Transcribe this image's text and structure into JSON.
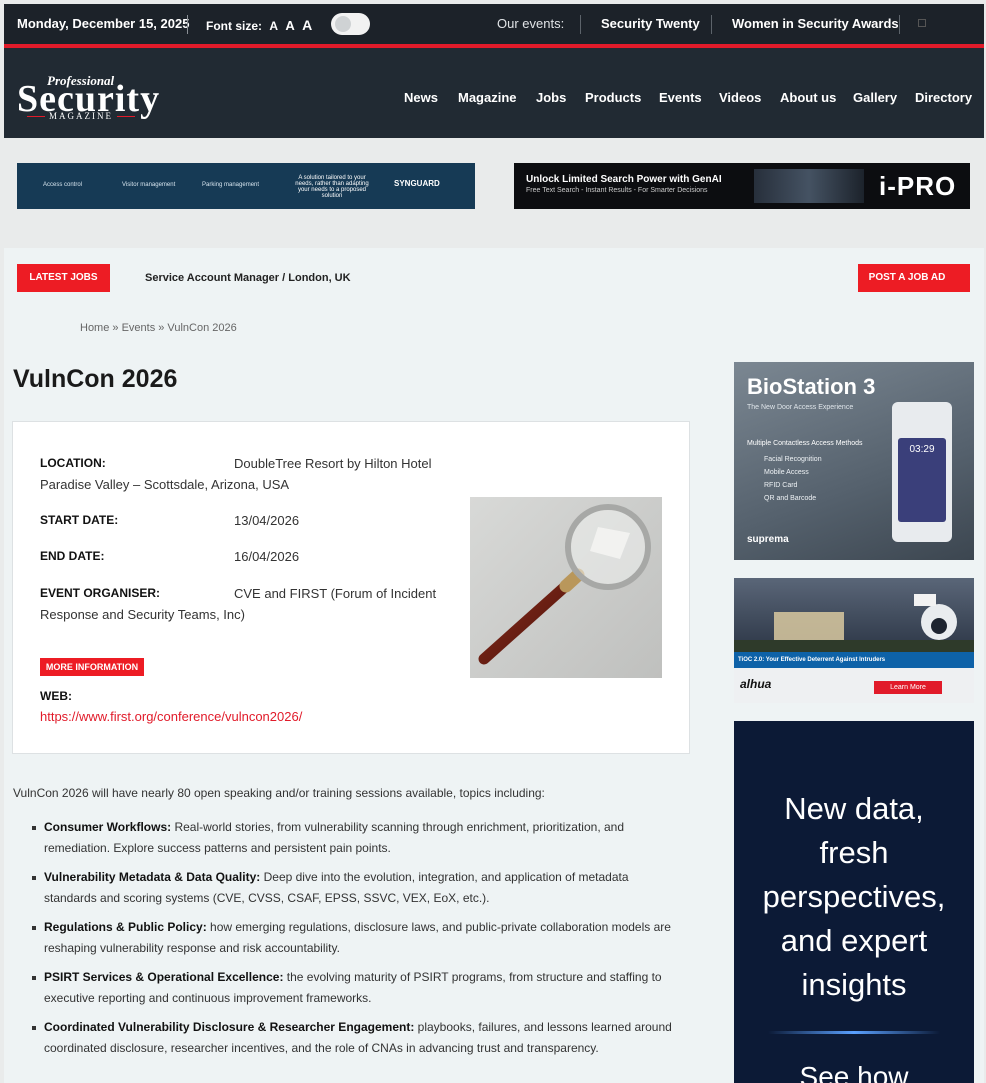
{
  "topbar": {
    "date": "Monday, December 15, 2025",
    "font_size_label": "Font size:",
    "font_a": "A",
    "events_label": "Our events:",
    "event1": "Security Twenty",
    "event2": "Women in Security Awards"
  },
  "header": {
    "logo_professional": "Professional",
    "logo_security": "Security",
    "logo_magazine": "MAGAZINE",
    "nav": [
      "News",
      "Magazine",
      "Jobs",
      "Products",
      "Events",
      "Videos",
      "About us",
      "Gallery",
      "Directory"
    ]
  },
  "ads": {
    "ad1_items": [
      "Access control",
      "Visitor management",
      "Parking management"
    ],
    "ad1_tagline": "A solution tailored to your needs, rather than adapting your needs to a proposed solution",
    "ad1_brand": "SYNGUARD",
    "ad2_title": "Unlock Limited Search Power with GenAI",
    "ad2_sub": "Free Text Search - Instant Results - For Smarter Decisions",
    "ad2_brand": "i-PRO"
  },
  "jobs": {
    "latest_label": "LATEST JOBS",
    "job": "Service Account Manager / London, UK",
    "post_label": "POST A JOB AD"
  },
  "breadcrumb": "Home » Events » VulnCon 2026",
  "event": {
    "title": "VulnCon 2026",
    "location_label": "LOCATION:",
    "location_value": "DoubleTree Resort by Hilton Hotel",
    "location_value2": "Paradise Valley – Scottsdale, Arizona, USA",
    "start_label": "START DATE:",
    "start_value": "13/04/2026",
    "end_label": "END DATE:",
    "end_value": "16/04/2026",
    "organiser_label": "EVENT ORGANISER:",
    "organiser_value": "CVE and FIRST (Forum of Incident",
    "organiser_value2": "Response and Security Teams, Inc)",
    "more_info": "MORE INFORMATION",
    "web_label": "WEB:",
    "web_url": "https://www.first.org/conference/vulncon2026/"
  },
  "content": {
    "intro": "VulnCon 2026 will have nearly 80 open speaking and/or training sessions available, topics including:",
    "bullets": [
      {
        "head": "Consumer Workflows:",
        "body": " Real-world stories, from vulnerability scanning through enrichment, prioritization, and remediation. Explore success patterns and persistent pain points."
      },
      {
        "head": "Vulnerability Metadata & Data Quality:",
        "body": " Deep dive into the evolution, integration, and application of metadata standards and scoring systems (CVE, CVSS, CSAF, EPSS, SSVC, VEX, EoX, etc.)."
      },
      {
        "head": "Regulations & Public Policy:",
        "body": " how emerging regulations, disclosure laws, and public-private collaboration models are reshaping vulnerability response and risk accountability."
      },
      {
        "head": "PSIRT Services & Operational Excellence:",
        "body": " the evolving maturity of PSIRT programs, from structure and staffing to executive reporting and continuous improvement frameworks."
      },
      {
        "head": "Coordinated Vulnerability Disclosure & Researcher Engagement:",
        "body": " playbooks, failures, and lessons learned around coordinated disclosure, researcher incentives, and the role of CNAs in advancing trust and transparency."
      }
    ]
  },
  "sidebar": {
    "biostation_title": "BioStation 3",
    "biostation_sub": "The New Door Access Experience",
    "biostation_methods": "Multiple Contactless Access Methods",
    "biostation_list": [
      "Facial Recognition",
      "Mobile Access",
      "RFID Card",
      "QR and Barcode"
    ],
    "biostation_time": "03:29",
    "biostation_brand": "suprema",
    "dahua_band": "TiOC 2.0: Your Effective Deterrent Against Intruders",
    "dahua_brand": "alhua",
    "dahua_learn": "Learn More",
    "promo_lines": "New data, fresh perspectives, and expert insights",
    "promo_more": "See how"
  }
}
